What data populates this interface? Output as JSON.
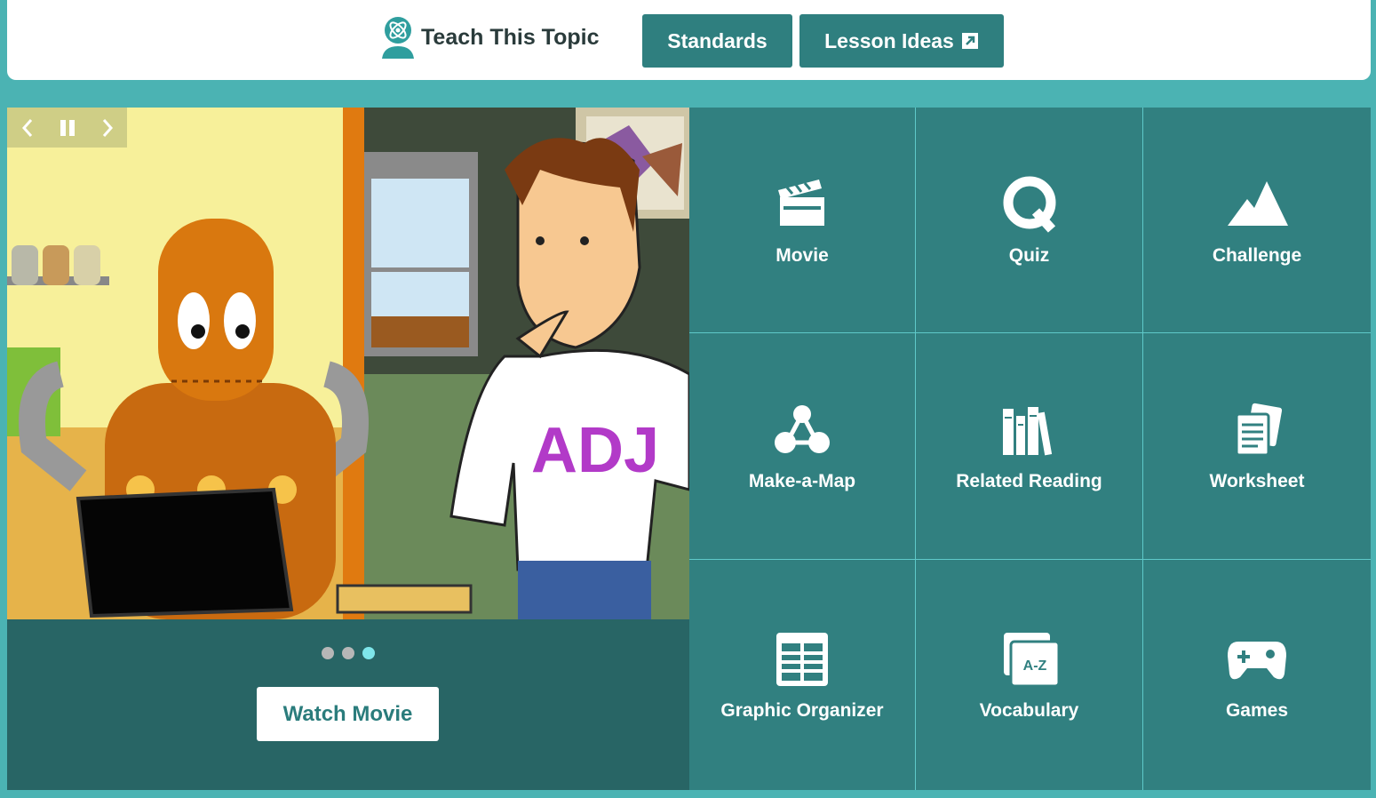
{
  "header": {
    "teach_label": "Teach This Topic",
    "standards_label": "Standards",
    "lesson_ideas_label": "Lesson Ideas"
  },
  "hero": {
    "shirt_text": "ADJ",
    "watch_label": "Watch Movie",
    "slides": 3,
    "active_slide": 3
  },
  "features": [
    {
      "label": "Movie",
      "icon": "clapperboard-icon"
    },
    {
      "label": "Quiz",
      "icon": "quiz-q-icon"
    },
    {
      "label": "Challenge",
      "icon": "mountain-icon"
    },
    {
      "label": "Make-a-Map",
      "icon": "concept-map-icon"
    },
    {
      "label": "Related Reading",
      "icon": "books-icon"
    },
    {
      "label": "Worksheet",
      "icon": "worksheet-icon"
    },
    {
      "label": "Graphic Organizer",
      "icon": "table-icon"
    },
    {
      "label": "Vocabulary",
      "icon": "a-z-cards-icon"
    },
    {
      "label": "Games",
      "icon": "gamepad-icon"
    }
  ],
  "colors": {
    "teal_dark": "#286565",
    "teal": "#318080",
    "teal_light": "#4bb3b3",
    "button": "#2f7f7f"
  }
}
